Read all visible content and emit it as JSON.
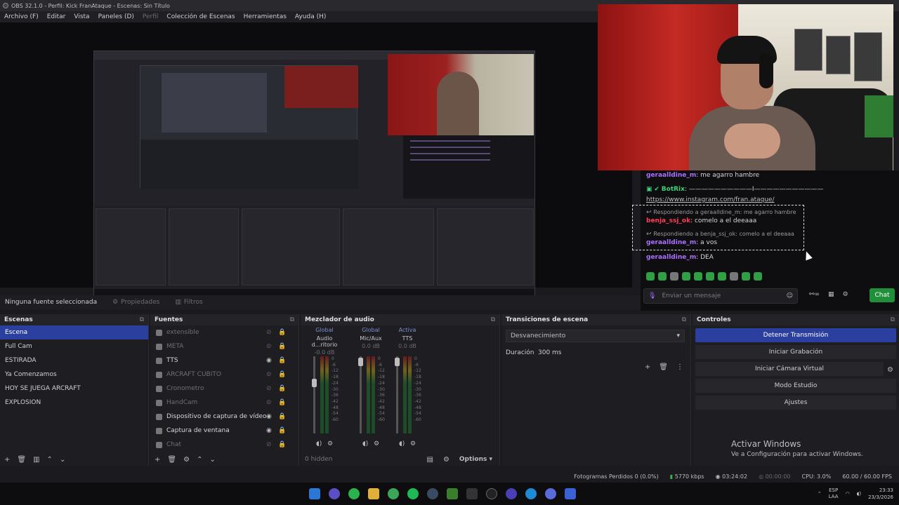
{
  "window": {
    "title": "OBS 32.1.0 - Perfil: Kick FranAtaque - Escenas: Sin Título"
  },
  "menu": {
    "items": [
      "Archivo (F)",
      "Editar",
      "Vista",
      "Paneles (D)",
      "Perfil",
      "Colección de Escenas",
      "Herramientas",
      "Ayuda (H)"
    ]
  },
  "chat": {
    "line1": {
      "user": "geraalldine_m",
      "text": ": me agarro hambre"
    },
    "line2": {
      "user": "BotRix",
      "text": ": ——————————I———————————"
    },
    "line3": {
      "link": "https://www.instagram.com/fran.ataque/"
    },
    "reply1": {
      "label": "Respondiendo a geraalldine_m: me agarro hambre",
      "user": "benja_ssj_ok",
      "text": ": comelo a el deeaaa"
    },
    "reply2": {
      "label": "Respondiendo a benja_ssj_ok: comelo a el deeaaa",
      "user": "geraalldine_m",
      "text": ": a vos"
    },
    "line6": {
      "user": "geraalldine_m",
      "text": ": DEA"
    },
    "input_placeholder": "Enviar un mensaje",
    "send_label": "Chat"
  },
  "source_bar": {
    "status": "Ninguna fuente seleccionada",
    "properties": "Propiedades",
    "filters": "Filtros"
  },
  "scenes": {
    "title": "Escenas",
    "items": [
      "Escena",
      "Full Cam",
      "ESTIRADA",
      "Ya Comenzamos",
      "HOY SE JUEGA ARCRAFT",
      "EXPLOSION"
    ],
    "selected": 0
  },
  "sources": {
    "title": "Fuentes",
    "items": [
      {
        "name": "extensible",
        "visible": false
      },
      {
        "name": "META",
        "visible": false
      },
      {
        "name": "TTS",
        "visible": true
      },
      {
        "name": "ARCRAFT CUBITO",
        "visible": false
      },
      {
        "name": "Cronometro",
        "visible": false
      },
      {
        "name": "HandCam",
        "visible": false
      },
      {
        "name": "Dispositivo de captura de vídeo",
        "visible": true
      },
      {
        "name": "Captura de ventana",
        "visible": true
      },
      {
        "name": "Chat",
        "visible": false
      }
    ]
  },
  "mixer": {
    "title": "Mezclador de audio",
    "channels": [
      {
        "tag": "Global",
        "name": "Audio d...ritorio",
        "db": "-0.0 dB"
      },
      {
        "tag": "Global",
        "name": "Mic/Aux",
        "db": "0.0 dB"
      },
      {
        "tag": "Activa",
        "name": "TTS",
        "db": "0.0 dB"
      }
    ],
    "scale": [
      "0",
      "-6",
      "-12",
      "-18",
      "-24",
      "-30",
      "-36",
      "-42",
      "-48",
      "-54",
      "-60"
    ],
    "hidden": "0 hidden",
    "options": "Options"
  },
  "transitions": {
    "title": "Transiciones de escena",
    "selected": "Desvanecimiento",
    "duration_label": "Duración",
    "duration_value": "300 ms"
  },
  "controls": {
    "title": "Controles",
    "buttons": [
      "Detener Transmisión",
      "Iniciar Grabación",
      "Iniciar Cámara Virtual",
      "Modo Estudio",
      "Ajustes"
    ]
  },
  "activate_windows": {
    "title": "Activar Windows",
    "subtitle": "Ve a Configuración para activar Windows."
  },
  "status": {
    "dropped": "Fotogramas Perdidos 0 (0.0%)",
    "bitrate": "5770 kbps",
    "stream_time": "03:24:02",
    "rec_time": "00:00:00",
    "cpu": "CPU: 3.0%",
    "fps": "60.00 / 60.00 FPS"
  },
  "taskbar": {
    "lang1": "ESP",
    "lang2": "LAA",
    "time": "23:33",
    "date": "23/3/2026"
  },
  "colors": {
    "accent_blue": "#2b3f9e",
    "chat_green": "#1f8f3a",
    "purple": "#a970ff",
    "red": "#ff3d5a"
  }
}
